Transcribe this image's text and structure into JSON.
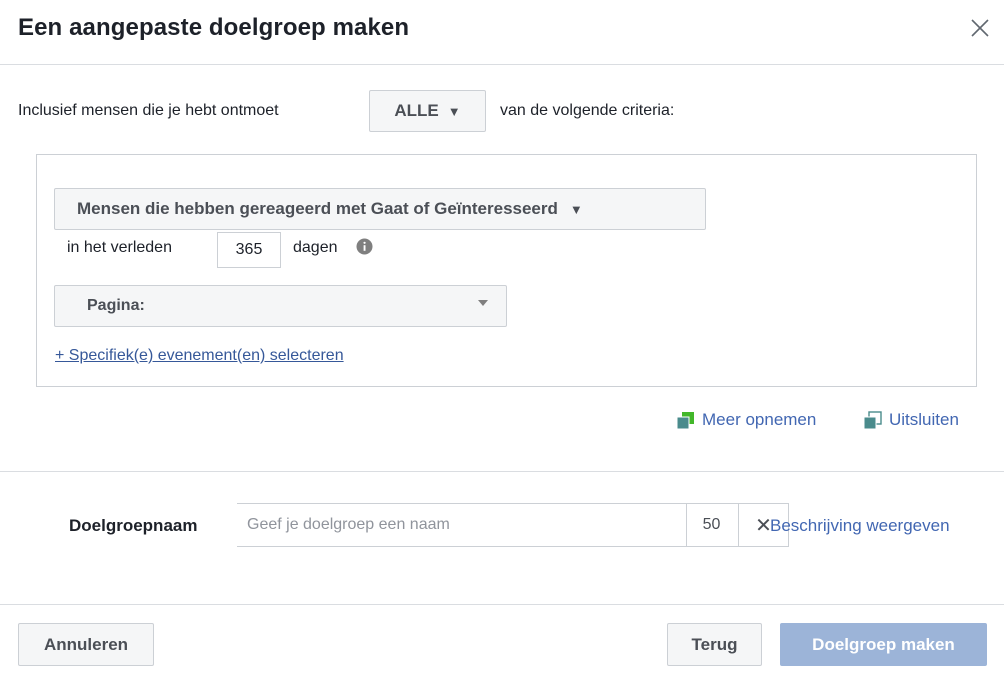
{
  "header": {
    "title": "Een aangepaste doelgroep maken"
  },
  "criteria": {
    "include_prefix": "Inclusief mensen die je hebt ontmoet",
    "match_select": "ALLE",
    "include_suffix": "van de volgende criteria:",
    "event_select": "Mensen die hebben gereageerd met Gaat of Geïnteresseerd",
    "past_label": "in het verleden",
    "days_value": "365",
    "days_label": "dagen",
    "page_select": "Pagina:",
    "specific_events_link": "+ Specifiek(e) evenement(en) selecteren"
  },
  "actions": {
    "include_more": "Meer opnemen",
    "exclude": "Uitsluiten"
  },
  "audience_name": {
    "label": "Doelgroepnaam",
    "placeholder": "Geef je doelgroep een naam",
    "value": "",
    "char_count": "50",
    "clear_glyph": "✕",
    "show_description": "Beschrijving weergeven"
  },
  "footer": {
    "cancel": "Annuleren",
    "back": "Terug",
    "create": "Doelgroep maken"
  },
  "colors": {
    "link": "#4267b2",
    "primary_disabled": "#9cb4d8",
    "icon_green": "#42b72a"
  }
}
